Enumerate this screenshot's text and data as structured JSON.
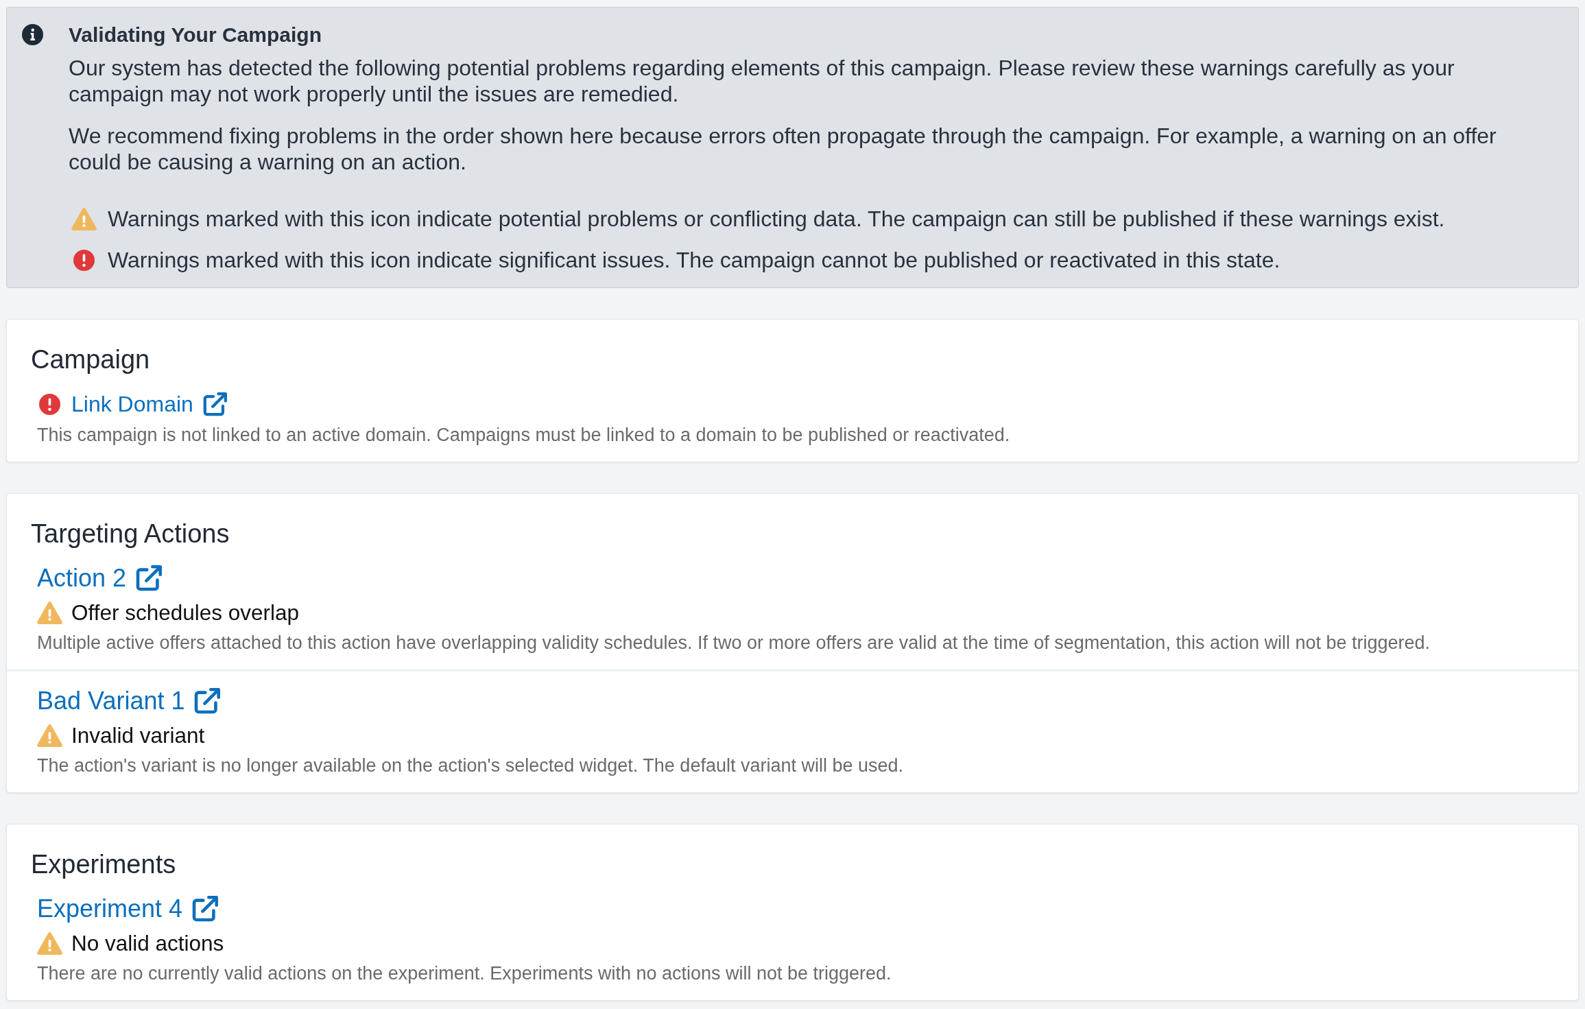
{
  "info_panel": {
    "title": "Validating Your Campaign",
    "paragraphs": [
      "Our system has detected the following potential problems regarding elements of this campaign. Please review these warnings carefully as your campaign may not work properly until the issues are remedied.",
      "We recommend fixing problems in the order shown here because errors often propagate through the campaign. For example, a warning on an offer could be causing a warning on an action."
    ],
    "legend": [
      {
        "blocking": false,
        "text": "Warnings marked with this icon indicate potential problems or conflicting data. The campaign can still be published if these warnings exist."
      },
      {
        "blocking": true,
        "text": "Warnings marked with this icon indicate significant issues. The campaign cannot be published or reactivated in this state."
      }
    ]
  },
  "sections": [
    {
      "title": "Campaign",
      "items": [
        {
          "kind": "linked_issue",
          "blocking": true,
          "link": "Link Domain",
          "description": "This campaign is not linked to an active domain. Campaigns must be linked to a domain to be published or reactivated."
        }
      ]
    },
    {
      "title": "Targeting Actions",
      "items": [
        {
          "kind": "titled_issue",
          "link": "Action 2",
          "blocking": false,
          "issue": "Offer schedules overlap",
          "description": "Multiple active offers attached to this action have overlapping validity schedules. If two or more offers are valid at the time of segmentation, this action will not be triggered."
        },
        {
          "kind": "titled_issue",
          "link": "Bad Variant 1",
          "blocking": false,
          "issue": "Invalid variant",
          "description": "The action's variant is no longer available on the action's selected widget. The default variant will be used."
        }
      ]
    },
    {
      "title": "Experiments",
      "items": [
        {
          "kind": "titled_issue",
          "link": "Experiment 4",
          "blocking": false,
          "issue": "No valid actions",
          "description": "There are no currently valid actions on the experiment. Experiments with no actions will not be triggered."
        }
      ]
    }
  ]
}
